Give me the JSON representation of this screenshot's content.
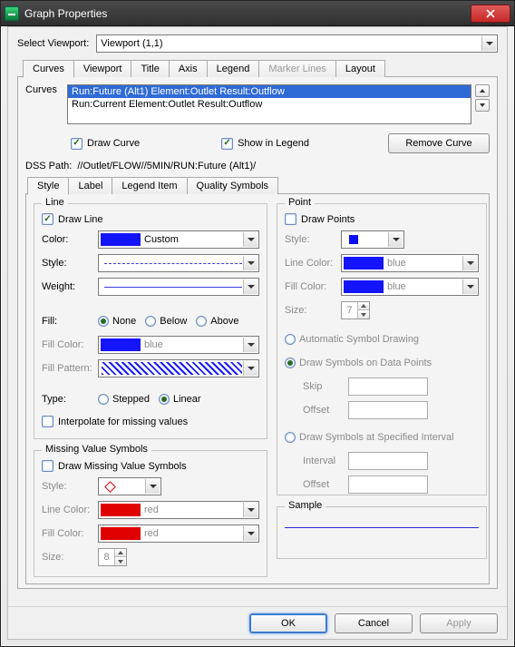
{
  "window": {
    "title": "Graph Properties"
  },
  "viewport": {
    "label": "Select Viewport:",
    "value": "Viewport (1,1)"
  },
  "mainTabs": [
    "Curves",
    "Viewport",
    "Title",
    "Axis",
    "Legend",
    "Marker Lines",
    "Layout"
  ],
  "curvesPanel": {
    "label": "Curves",
    "items": [
      "Run:Future (Alt1) Element:Outlet Result:Outflow",
      "Run:Current Element:Outlet Result:Outflow"
    ],
    "drawCurve": "Draw Curve",
    "showInLegend": "Show in Legend",
    "removeCurve": "Remove Curve",
    "dssPathLabel": "DSS Path:",
    "dssPathValue": "//Outlet/FLOW//5MIN/RUN:Future (Alt1)/"
  },
  "subTabs": [
    "Style",
    "Label",
    "Legend Item",
    "Quality Symbols"
  ],
  "style": {
    "line": {
      "legend": "Line",
      "drawLine": "Draw Line",
      "colorLabel": "Color:",
      "colorName": "Custom",
      "styleLabel": "Style:",
      "weightLabel": "Weight:",
      "fillLabel": "Fill:",
      "fillOptions": [
        "None",
        "Below",
        "Above"
      ],
      "fillColorLabel": "Fill Color:",
      "fillColorName": "blue",
      "fillPatternLabel": "Fill Pattern:",
      "typeLabel": "Type:",
      "typeOptions": [
        "Stepped",
        "Linear"
      ],
      "interpolate": "Interpolate for missing values"
    },
    "missing": {
      "legend": "Missing Value Symbols",
      "draw": "Draw Missing Value Symbols",
      "styleLabel": "Style:",
      "lineColorLabel": "Line Color:",
      "lineColorName": "red",
      "fillColorLabel": "Fill Color:",
      "fillColorName": "red",
      "sizeLabel": "Size:",
      "sizeValue": "8"
    },
    "point": {
      "legend": "Point",
      "drawPoints": "Draw Points",
      "styleLabel": "Style:",
      "lineColorLabel": "Line Color:",
      "lineColorName": "blue",
      "fillColorLabel": "Fill Color:",
      "fillColorName": "blue",
      "sizeLabel": "Size:",
      "sizeValue": "7",
      "auto": "Automatic Symbol Drawing",
      "onData": "Draw Symbols on Data Points",
      "skipLabel": "Skip",
      "offsetLabel": "Offset",
      "atInterval": "Draw Symbols at Specified Interval",
      "intervalLabel": "Interval"
    },
    "sample": {
      "legend": "Sample"
    }
  },
  "buttons": {
    "ok": "OK",
    "cancel": "Cancel",
    "apply": "Apply"
  }
}
